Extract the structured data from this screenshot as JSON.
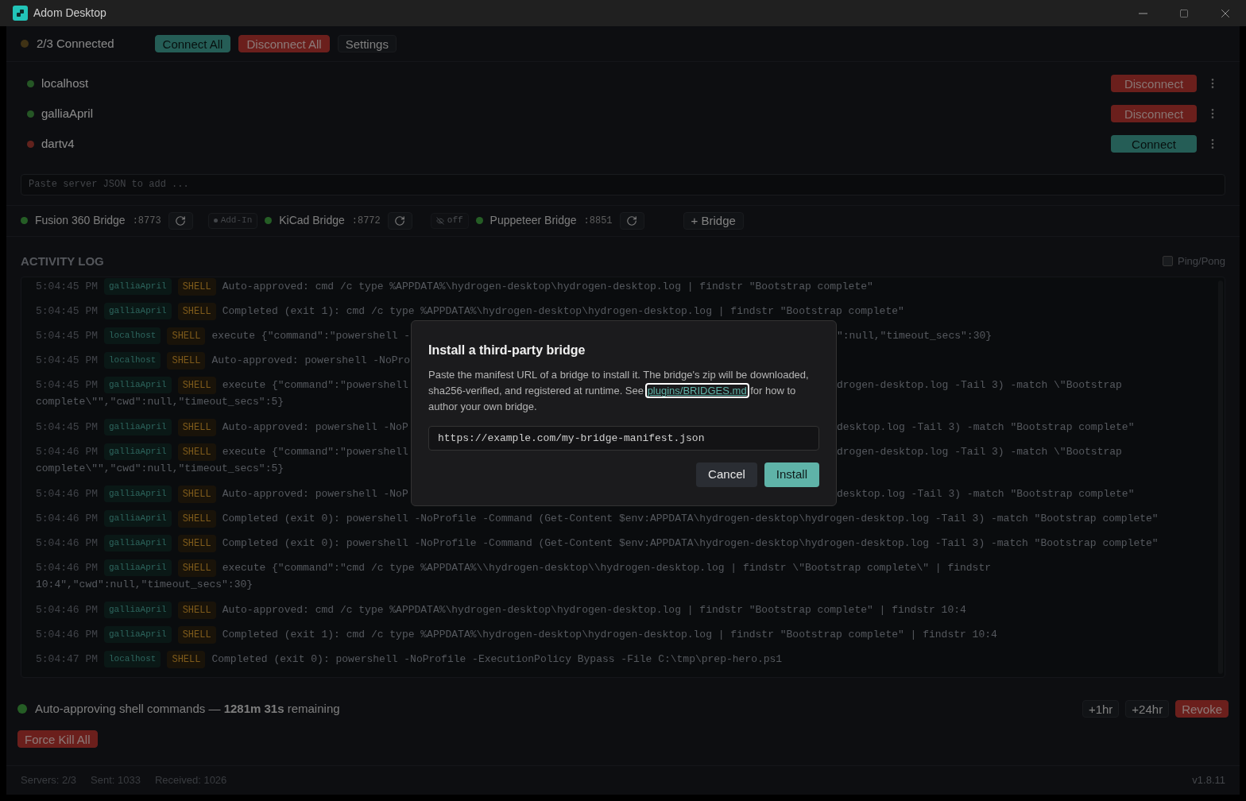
{
  "window": {
    "title": "Adom Desktop"
  },
  "toolbar": {
    "status": "2/3 Connected",
    "all_connected": false,
    "buttons": [
      {
        "kind": "connect",
        "label": "Connect All"
      },
      {
        "kind": "disconnect",
        "label": "Disconnect All"
      },
      {
        "kind": "plain",
        "label": "Settings"
      }
    ]
  },
  "servers": [
    {
      "name": "localhost",
      "connected": true,
      "action": "Disconnect"
    },
    {
      "name": "galliaApril",
      "connected": true,
      "action": "Disconnect"
    },
    {
      "name": "dartv4",
      "connected": false,
      "action": "Connect"
    }
  ],
  "server_input": {
    "placeholder": "Paste server JSON to add ..."
  },
  "bridges": [
    {
      "name": "Fusion 360 Bridge",
      "port": ":8773",
      "running": true,
      "badge": {
        "kind": "addin",
        "label": "Add-In"
      }
    },
    {
      "name": "KiCad Bridge",
      "port": ":8772",
      "running": true,
      "badge": {
        "kind": "off",
        "label": "off"
      }
    },
    {
      "name": "Puppeteer Bridge",
      "port": ":8851",
      "running": true
    }
  ],
  "add_bridge": "+ Bridge",
  "activity_log": {
    "title": "ACTIVITY LOG",
    "ping_pong": {
      "label": "Ping/Pong",
      "checked": false
    },
    "rows": [
      {
        "time": "5:04:45 PM",
        "server": "galliaApril",
        "kind": "SHELL",
        "text": "Auto-approved: cmd /c type %APPDATA%\\hydrogen-desktop\\hydrogen-desktop.log | findstr \"Bootstrap complete\""
      },
      {
        "time": "5:04:45 PM",
        "server": "galliaApril",
        "kind": "SHELL",
        "text": "Completed (exit 1): cmd /c type %APPDATA%\\hydrogen-desktop\\hydrogen-desktop.log | findstr \"Bootstrap complete\""
      },
      {
        "time": "5:04:45 PM",
        "server": "localhost",
        "kind": "SHELL",
        "text": "execute {\"command\":\"powershell -",
        "text_after": "\":null,\"timeout_secs\":30}"
      },
      {
        "time": "5:04:45 PM",
        "server": "localhost",
        "kind": "SHELL",
        "text": "Auto-approved: powershell -NoPro"
      },
      {
        "time": "5:04:45 PM",
        "server": "galliaApril",
        "kind": "SHELL",
        "text": "execute {\"command\":\"powershell",
        "text_after": "drogen-desktop.log -Tail 3) -match \\\"Bootstrap",
        "continuation": "complete\\\"\",\"cwd\":null,\"timeout_secs\":5}"
      },
      {
        "time": "5:04:45 PM",
        "server": "galliaApril",
        "kind": "SHELL",
        "text": "Auto-approved: powershell -NoP",
        "text_after": "desktop.log -Tail 3) -match \"Bootstrap complete\""
      },
      {
        "time": "5:04:46 PM",
        "server": "galliaApril",
        "kind": "SHELL",
        "text": "execute {\"command\":\"powershell",
        "text_after": "drogen-desktop.log -Tail 3) -match \\\"Bootstrap",
        "continuation": "complete\\\"\",\"cwd\":null,\"timeout_secs\":5}"
      },
      {
        "time": "5:04:46 PM",
        "server": "galliaApril",
        "kind": "SHELL",
        "text": "Auto-approved: powershell -NoP",
        "text_after": "desktop.log -Tail 3) -match \"Bootstrap complete\""
      },
      {
        "time": "5:04:46 PM",
        "server": "galliaApril",
        "kind": "SHELL",
        "text": "Completed (exit 0): powershell -NoProfile -Command (Get-Content $env:APPDATA\\hydrogen-desktop\\hydrogen-desktop.log -Tail 3) -match \"Bootstrap complete\""
      },
      {
        "time": "5:04:46 PM",
        "server": "galliaApril",
        "kind": "SHELL",
        "text": "Completed (exit 0): powershell -NoProfile -Command (Get-Content $env:APPDATA\\hydrogen-desktop\\hydrogen-desktop.log -Tail 3) -match \"Bootstrap complete\""
      },
      {
        "time": "5:04:46 PM",
        "server": "galliaApril",
        "kind": "SHELL",
        "text": "execute {\"command\":\"cmd /c type %APPDATA%\\\\hydrogen-desktop\\\\hydrogen-desktop.log | findstr \\\"Bootstrap complete\\\" | findstr",
        "continuation": "10:4\",\"cwd\":null,\"timeout_secs\":30}"
      },
      {
        "time": "5:04:46 PM",
        "server": "galliaApril",
        "kind": "SHELL",
        "text": "Auto-approved: cmd /c type %APPDATA%\\hydrogen-desktop\\hydrogen-desktop.log | findstr \"Bootstrap complete\" | findstr 10:4"
      },
      {
        "time": "5:04:46 PM",
        "server": "galliaApril",
        "kind": "SHELL",
        "text": "Completed (exit 1): cmd /c type %APPDATA%\\hydrogen-desktop\\hydrogen-desktop.log | findstr \"Bootstrap complete\" | findstr 10:4"
      },
      {
        "time": "5:04:47 PM",
        "server": "localhost",
        "kind": "SHELL",
        "text": "Completed (exit 0): powershell -NoProfile -ExecutionPolicy Bypass -File C:\\tmp\\prep-hero.ps1"
      }
    ]
  },
  "auto_approve": {
    "active": true,
    "text": "Auto-approving shell commands — **1281m 31s** remaining",
    "buttons": [
      {
        "kind": "plain",
        "label": "+1hr"
      },
      {
        "kind": "plain",
        "label": "+24hr"
      },
      {
        "kind": "danger",
        "label": "Revoke"
      }
    ]
  },
  "force_kill": "Force Kill All",
  "status_bar": {
    "servers": "Servers: 2/3",
    "sent": "Sent: 1033",
    "received": "Received: 1026",
    "version": "v1.8.11"
  },
  "dialog": {
    "title": "Install a third-party bridge",
    "body_before": "Paste the manifest URL of a bridge to install it. The bridge's zip will be downloaded, sha256-verified, and registered at runtime. See",
    "link": "plugins/BRIDGES.md",
    "body_after": "for how to author your own bridge.",
    "input": {
      "placeholder": "https://example.com/my-bridge-manifest.json"
    },
    "buttons": [
      {
        "kind": "secondary",
        "label": "Cancel"
      },
      {
        "kind": "primary",
        "label": "Install"
      }
    ]
  }
}
